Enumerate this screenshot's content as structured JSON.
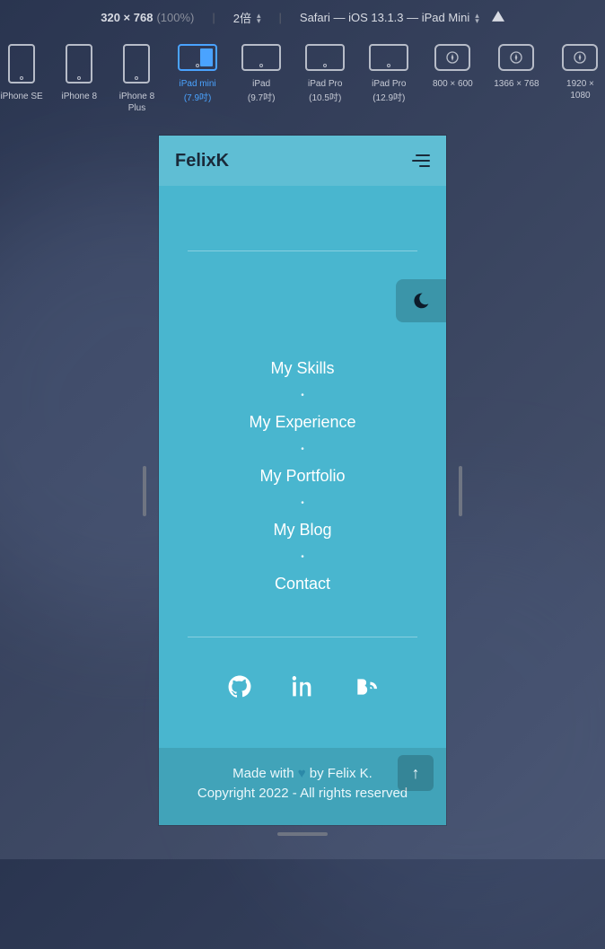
{
  "devtools": {
    "dimensions": "320 × 768",
    "zoom_pct": "(100%)",
    "scale": "2倍",
    "ua_label": "Safari — iOS 13.1.3 — iPad Mini"
  },
  "devices": [
    {
      "name": "iPhone SE",
      "sub": "",
      "shape": "tall",
      "selected": false
    },
    {
      "name": "iPhone 8",
      "sub": "",
      "shape": "tall",
      "selected": false
    },
    {
      "name": "iPhone 8 Plus",
      "sub": "",
      "shape": "tall",
      "selected": false
    },
    {
      "name": "iPad mini",
      "sub": "(7.9吋)",
      "shape": "wide",
      "selected": true
    },
    {
      "name": "iPad",
      "sub": "(9.7吋)",
      "shape": "wide",
      "selected": false
    },
    {
      "name": "iPad Pro",
      "sub": "(10.5吋)",
      "shape": "wide",
      "selected": false
    },
    {
      "name": "iPad Pro",
      "sub": "(12.9吋)",
      "shape": "wide",
      "selected": false
    },
    {
      "name": "800 × 600",
      "sub": "",
      "shape": "square",
      "selected": false
    },
    {
      "name": "1366 × 768",
      "sub": "",
      "shape": "square",
      "selected": false
    },
    {
      "name": "1920 × 1080",
      "sub": "",
      "shape": "square",
      "selected": false
    }
  ],
  "page": {
    "brand": "FelixK",
    "nav": [
      "My Skills",
      "My Experience",
      "My Portfolio",
      "My Blog",
      "Contact"
    ],
    "social": [
      "github",
      "linkedin",
      "blog"
    ],
    "footer_line1_pre": "Made with",
    "footer_line1_post": "by Felix K.",
    "footer_line2": "Copyright 2022 - All rights reserved",
    "theme_icon": "moon",
    "scrolltop_icon": "arrow-up"
  },
  "colors": {
    "page_bg": "#49b6cf",
    "text_light": "#ffffff"
  }
}
